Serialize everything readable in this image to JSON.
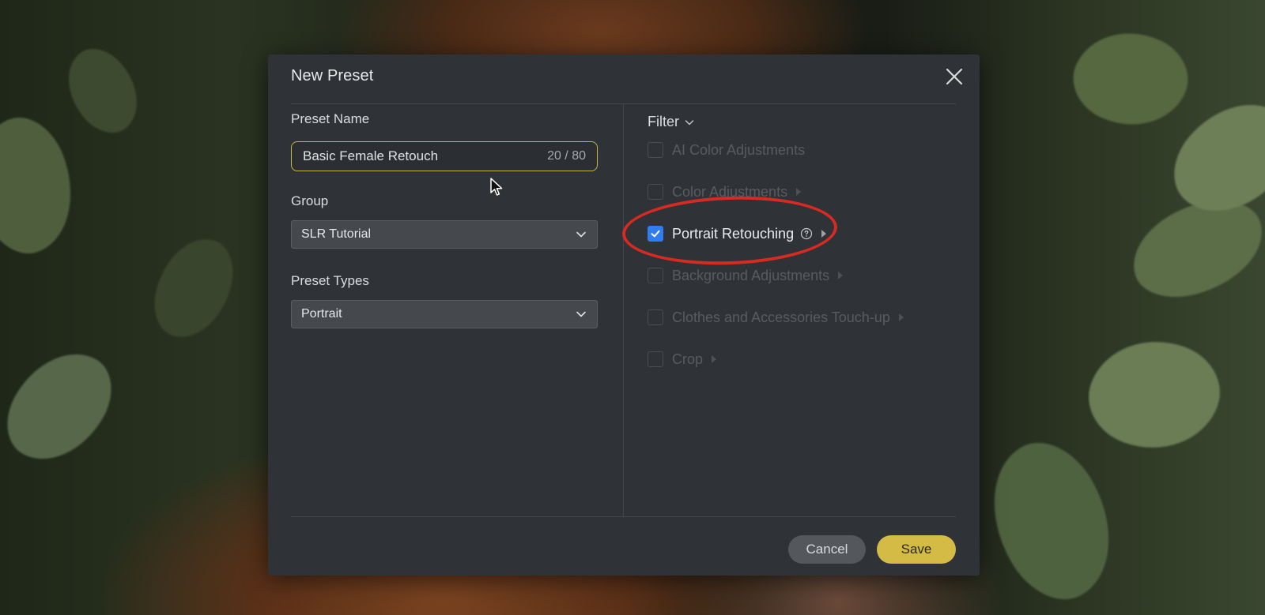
{
  "dialog": {
    "title": "New Preset",
    "close_icon": "close-icon"
  },
  "preset_name": {
    "label": "Preset Name",
    "value": "Basic Female Retouch",
    "counter": "20 / 80"
  },
  "group": {
    "label": "Group",
    "selected": "SLR Tutorial"
  },
  "preset_types": {
    "label": "Preset Types",
    "selected": "Portrait"
  },
  "filter": {
    "label": "Filter",
    "options": [
      {
        "label": "AI Color Adjustments",
        "checked": false,
        "enabled": false,
        "has_submenu": false
      },
      {
        "label": "Color Adjustments",
        "checked": false,
        "enabled": false,
        "has_submenu": true
      },
      {
        "label": "Portrait Retouching",
        "checked": true,
        "enabled": true,
        "has_submenu": true,
        "has_help": true
      },
      {
        "label": "Background Adjustments",
        "checked": false,
        "enabled": false,
        "has_submenu": true
      },
      {
        "label": "Clothes and Accessories Touch-up",
        "checked": false,
        "enabled": false,
        "has_submenu": true
      },
      {
        "label": "Crop",
        "checked": false,
        "enabled": false,
        "has_submenu": true
      }
    ]
  },
  "footer": {
    "cancel_label": "Cancel",
    "save_label": "Save"
  },
  "colors": {
    "dialog_bg": "#2f3236",
    "accent_save": "#d3bb45",
    "checkbox_on": "#2f7df0",
    "highlight_ring": "#d62a22",
    "input_focus": "#c9b546"
  }
}
